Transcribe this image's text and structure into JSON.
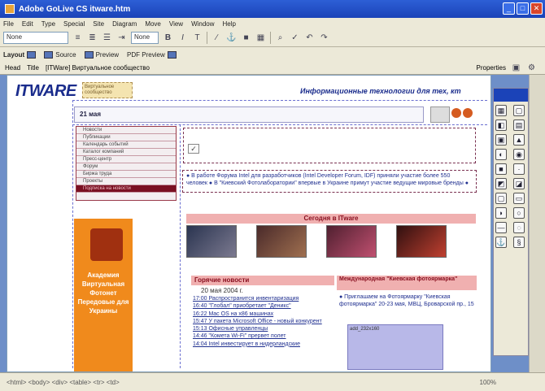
{
  "window": {
    "title": "Adobe GoLive CS  itware.htm"
  },
  "menu": [
    "File",
    "Edit",
    "Type",
    "Special",
    "Site",
    "Diagram",
    "Move",
    "View",
    "Window",
    "Help"
  ],
  "toolbar": {
    "format_select": "None",
    "style_select": "None"
  },
  "tabs": {
    "layout": "Layout",
    "source": "Source",
    "preview": "Preview",
    "pdf_preview": "PDF Preview"
  },
  "head_bar": {
    "head_label": "Head",
    "title_label": "Title",
    "title_value": "[ITWare] Виртуальное сообщество",
    "properties_label": "Properties"
  },
  "page": {
    "logo": "ITWARE",
    "logo_sub": "Виртуальное сообщество",
    "tagline": "Информационные технологии для тех, кт",
    "date": "21 мая",
    "menu_items": [
      "Новости",
      "Публикации",
      "Календарь событий",
      "Каталог компаний",
      "Пресс-центр",
      "Форум",
      "Биржа труда",
      "Проекты",
      "Подписка на новости"
    ],
    "news_text": "● В работе Форума Intel для разработчиков (Intel Developer Forum, IDF) приняли участие более 550 человек ● В \"Киевский Фотолаборатории\" впервые в Украине примут участие ведущие мировые бренды ●",
    "promo_text": "Академия Виртуальная Фотонет Передовые для Украины",
    "today_head": "Сегодня в ITware",
    "fresh_head": "Горячие новости",
    "fresh_date": "20 мая 2004 г.",
    "fresh_items": [
      "17:00 Распространится инвентаризация",
      "16:40 \"Глобал\" приобретает \"Деникс\"",
      "16:22 Mac OS на x86 машинах",
      "15:47 У пакета Microsoft Office - новый конкурент",
      "15:13 Офисные управленцы",
      "14:46 \"Комета Wi-Fi\" прервет полет",
      "14:04 Intel инвестирует в нидерландские"
    ],
    "exh_head": "Международная \"Киевская фотоярмарка\"",
    "exh_text": "● Приглашаем на Фотоярмарку \"Киевская фотоярмарка\" 20-23 мая, МВЦ, Броварской пр., 15",
    "ad_label": "add_232x160"
  },
  "status": {
    "path": "<html> <body> <div> <table> <tr> <td>",
    "zoom": "100%"
  },
  "colors": {
    "titlebar": "#2d5fd6",
    "dark_menu": "#7a1022",
    "promo": "#f08a1c",
    "link": "#203090"
  }
}
